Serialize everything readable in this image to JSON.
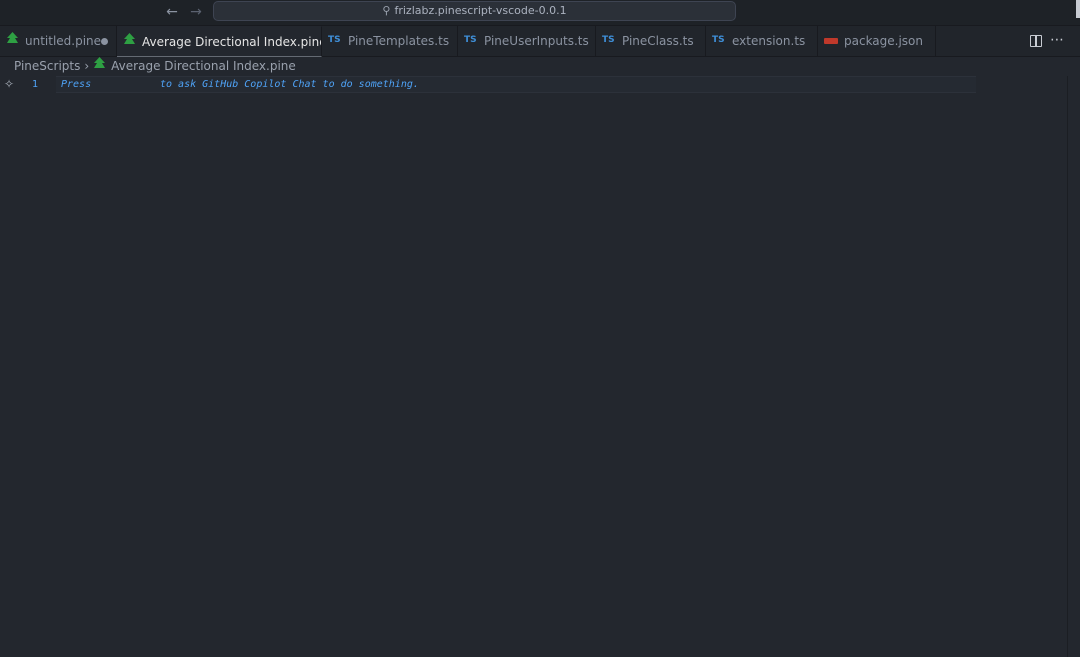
{
  "titlebar": {
    "command_center_text": "frizlabz.pinescript-vscode-0.0.1",
    "back_icon": "arrow-left-icon",
    "forward_icon": "arrow-right-icon",
    "search_icon": "search-icon"
  },
  "tabs": [
    {
      "label": "untitled.pine",
      "icon": "pine-tree-icon",
      "dirty": true,
      "active": false
    },
    {
      "label": "Average Directional Index.pine",
      "icon": "pine-tree-icon",
      "dirty": false,
      "active": true
    },
    {
      "label": "PineTemplates.ts",
      "icon": "typescript-icon",
      "active": false
    },
    {
      "label": "PineUserInputs.ts",
      "icon": "typescript-icon",
      "active": false
    },
    {
      "label": "PineClass.ts",
      "icon": "typescript-icon",
      "active": false
    },
    {
      "label": "extension.ts",
      "icon": "typescript-icon",
      "active": false
    },
    {
      "label": "package.json",
      "icon": "npm-icon",
      "active": false
    }
  ],
  "ts_badge": "TS",
  "breadcrumb": {
    "folder": "PineScripts",
    "file": "Average Directional Index.pine"
  },
  "editor": {
    "line_number": "1",
    "hint_part1": "Press",
    "hint_part2": "to ask GitHub Copilot Chat to do something."
  },
  "colors": {
    "accent_blue": "#4fa3f7",
    "pine_green": "#2ea043",
    "ts_blue": "#3f8fd8",
    "npm_red": "#c0392b",
    "background": "#23272e"
  }
}
